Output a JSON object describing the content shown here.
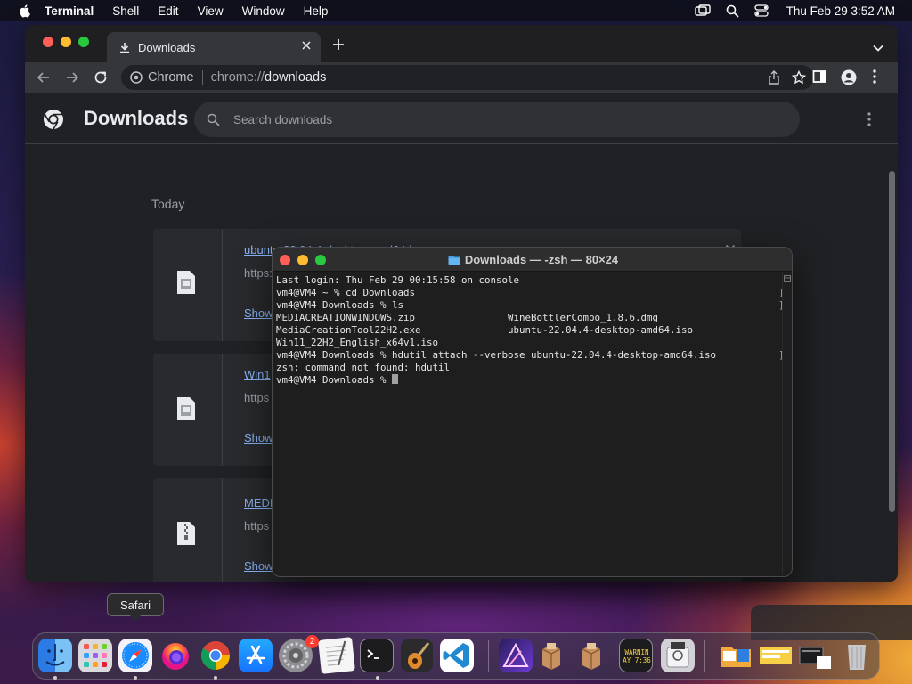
{
  "menubar": {
    "app": "Terminal",
    "items": [
      "Shell",
      "Edit",
      "View",
      "Window",
      "Help"
    ],
    "clock": "Thu Feb 29  3:52 AM",
    "icons": [
      "screen-mirroring-icon",
      "spotlight-search-icon",
      "control-center-icon"
    ]
  },
  "browser": {
    "tab_title": "Downloads",
    "omnibox": {
      "site": "Chrome",
      "url_scheme": "chrome://",
      "url_host": "downloads"
    },
    "page_title": "Downloads",
    "search_placeholder": "Search downloads",
    "section_label": "Today",
    "downloads": [
      {
        "name": "ubuntu-22.04.4-desktop-amd64.iso",
        "source": "https://",
        "action": "Show"
      },
      {
        "name": "Win1",
        "source": "https",
        "action": "Show"
      },
      {
        "name": "MEDI",
        "source": "https",
        "action": "Show"
      }
    ]
  },
  "terminal": {
    "title": "Downloads — -zsh — 80×24",
    "lines": [
      "Last login: Thu Feb 29 00:15:58 on console",
      "vm4@VM4 ~ % cd Downloads",
      "vm4@VM4 Downloads % ls",
      "MEDIACREATIONWINDOWS.zip                WineBottlerCombo_1.8.6.dmg",
      "MediaCreationTool22H2.exe               ubuntu-22.04.4-desktop-amd64.iso",
      "Win11_22H2_English_x64v1.iso",
      "vm4@VM4 Downloads % hdutil attach --verbose ubuntu-22.04.4-desktop-amd64.iso",
      "zsh: command not found: hdutil"
    ],
    "prompt": "vm4@VM4 Downloads % "
  },
  "dock": {
    "tooltip": "Safari",
    "settings_badge": "2",
    "console_badge": "WARNIN\nAY 7:36",
    "apps": [
      "Finder",
      "Launchpad",
      "Safari",
      "Firefox",
      "Google Chrome",
      "App Store",
      "System Settings",
      "TextEdit",
      "Terminal",
      "GarageBand",
      "Visual Studio Code",
      "Affinity Designer",
      "Installer Package",
      "Installer Package",
      "Console",
      "Disk Utility",
      "Downloads Folder",
      "Documents",
      "Screenshots",
      "Trash"
    ]
  },
  "colors": {
    "link": "#8ab4f8",
    "chrome_bg": "#202124",
    "terminal_bg": "#1e1e1e",
    "badge": "#ff3b30"
  }
}
